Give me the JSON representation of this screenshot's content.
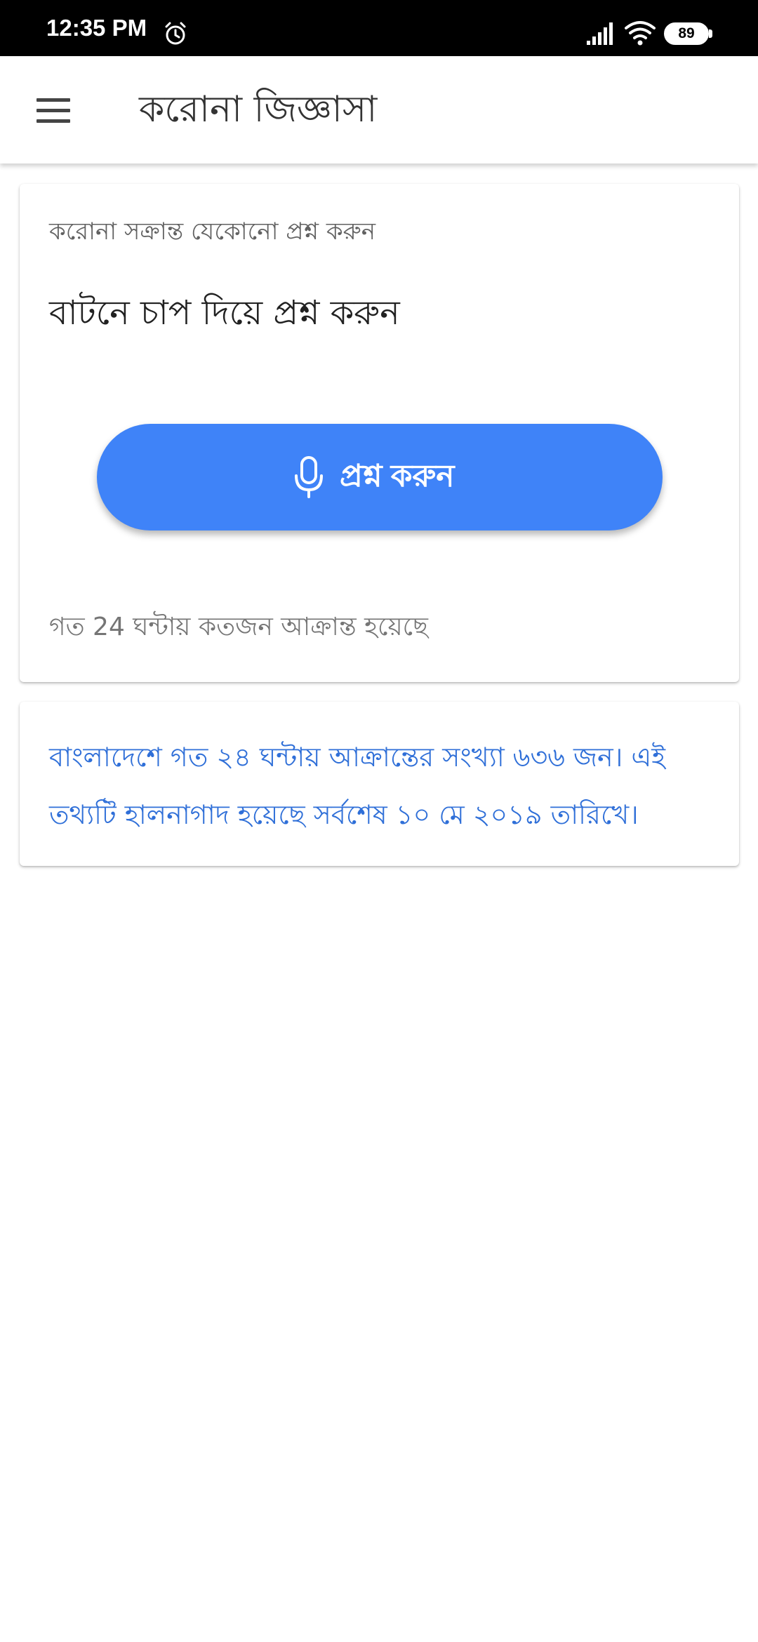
{
  "status_bar": {
    "time": "12:35 PM",
    "battery": "89",
    "icons": [
      "alarm-icon",
      "signal-icon",
      "wifi-icon",
      "battery-icon"
    ]
  },
  "app_bar": {
    "title": "করোনা জিজ্ঞাসা",
    "menu_icon": "hamburger-menu-icon"
  },
  "main_card": {
    "subtitle": "করোনা সক্রান্ত যেকোনো প্রশ্ন করুন",
    "heading": "বাটনে চাপ দিয়ে প্রশ্ন করুন",
    "ask_button_label": "প্রশ্ন করুন",
    "ask_button_icon": "microphone-icon",
    "footer": "গত 24 ঘন্টায় কতজন আক্রান্ত হয়েছে"
  },
  "info_card": {
    "text": "বাংলাদেশে গত ২৪ ঘন্টায় আক্রান্তের সংখ্যা ৬৩৬ জন। এই তথ্যটি হালনাগাদ হয়েছে সর্বশেষ ১০ মে ২০১৯ তারিখে।"
  },
  "colors": {
    "accent": "#3f83f8",
    "info_text": "#2f6fd8",
    "status_bar": "#000000"
  }
}
